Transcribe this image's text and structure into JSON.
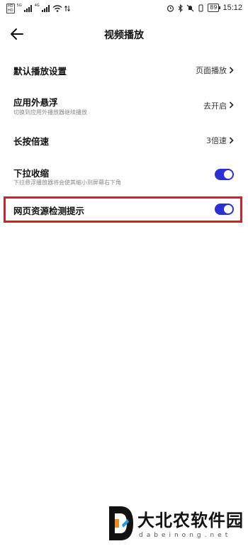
{
  "status_bar": {
    "hd_top": "HD",
    "hd_bottom": "HD",
    "net_1": "5G",
    "net_2": "4G",
    "battery": "89",
    "time": "15:12"
  },
  "header": {
    "title": "视频播放"
  },
  "settings": {
    "default_playback": {
      "title": "默认播放设置",
      "value": "页面播放"
    },
    "floating": {
      "title": "应用外悬浮",
      "subtitle": "切换到应用外播放器继续播放",
      "value": "去开启"
    },
    "long_press": {
      "title": "长按倍速",
      "value": "3倍速"
    },
    "pull_down": {
      "title": "下拉收缩",
      "subtitle": "下拉悬浮播放器将会使其缩小到屏幕右下角",
      "enabled": true
    },
    "resource_detect": {
      "title": "网页资源检测提示",
      "enabled": true
    }
  },
  "colors": {
    "toggle_on": "#2b2fd6",
    "highlight": "#d1202a"
  },
  "watermark": {
    "name": "大北农软件园",
    "domain": "dabeinong.net"
  }
}
